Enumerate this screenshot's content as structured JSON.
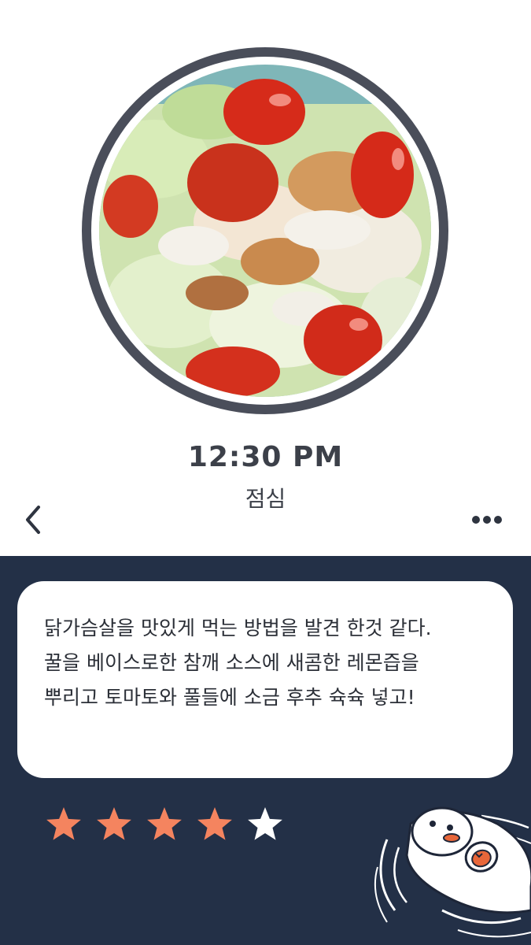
{
  "entry": {
    "time": "12:30 PM",
    "meal": "점심",
    "photo": "salad-photo",
    "diary": "닭가슴살을 맛있게 먹는 방법을 발견 한것 같다.\n꿀을 베이스로한 참깨 소스에 새콤한 레몬즙을\n뿌리고 토마토와 풀들에 소금 후추 슉슉 넣고!",
    "rating": 4,
    "rating_max": 5
  },
  "nav": {
    "back_icon": "chevron-left-icon",
    "more_icon": "more-horizontal-icon"
  },
  "colors": {
    "dark_panel": "#233047",
    "ring": "#4a4e5a",
    "text": "#3c4049",
    "star_filled": "#f4845f",
    "star_empty": "#ffffff"
  }
}
